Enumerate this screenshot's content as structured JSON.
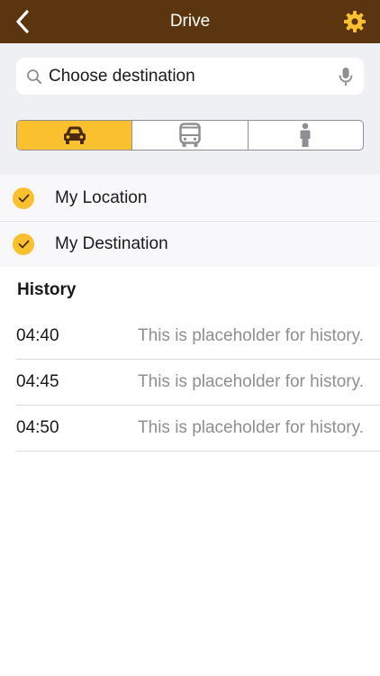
{
  "nav": {
    "title": "Drive",
    "back_icon": "chevron-left-icon",
    "settings_icon": "gear-icon"
  },
  "search": {
    "placeholder": "Choose destination",
    "search_icon": "magnifier-icon",
    "mic_icon": "microphone-icon"
  },
  "modes": [
    {
      "name": "car",
      "icon": "car-icon",
      "selected": true
    },
    {
      "name": "transit",
      "icon": "bus-icon",
      "selected": false
    },
    {
      "name": "walk",
      "icon": "person-icon",
      "selected": false
    }
  ],
  "waypoints": [
    {
      "label": "My Location",
      "checked": true
    },
    {
      "label": "My Destination",
      "checked": true
    }
  ],
  "history": {
    "title": "History",
    "items": [
      {
        "time": "04:40",
        "note": "This is placeholder for history."
      },
      {
        "time": "04:45",
        "note": "This is placeholder for history."
      },
      {
        "time": "04:50",
        "note": "This is placeholder for history."
      }
    ]
  },
  "colors": {
    "navbar": "#5a3510",
    "accent": "#fbc02d",
    "panel_bg": "#eff0f4",
    "icon_inactive": "#8e8e93",
    "car_icon": "#4a2c0c"
  }
}
